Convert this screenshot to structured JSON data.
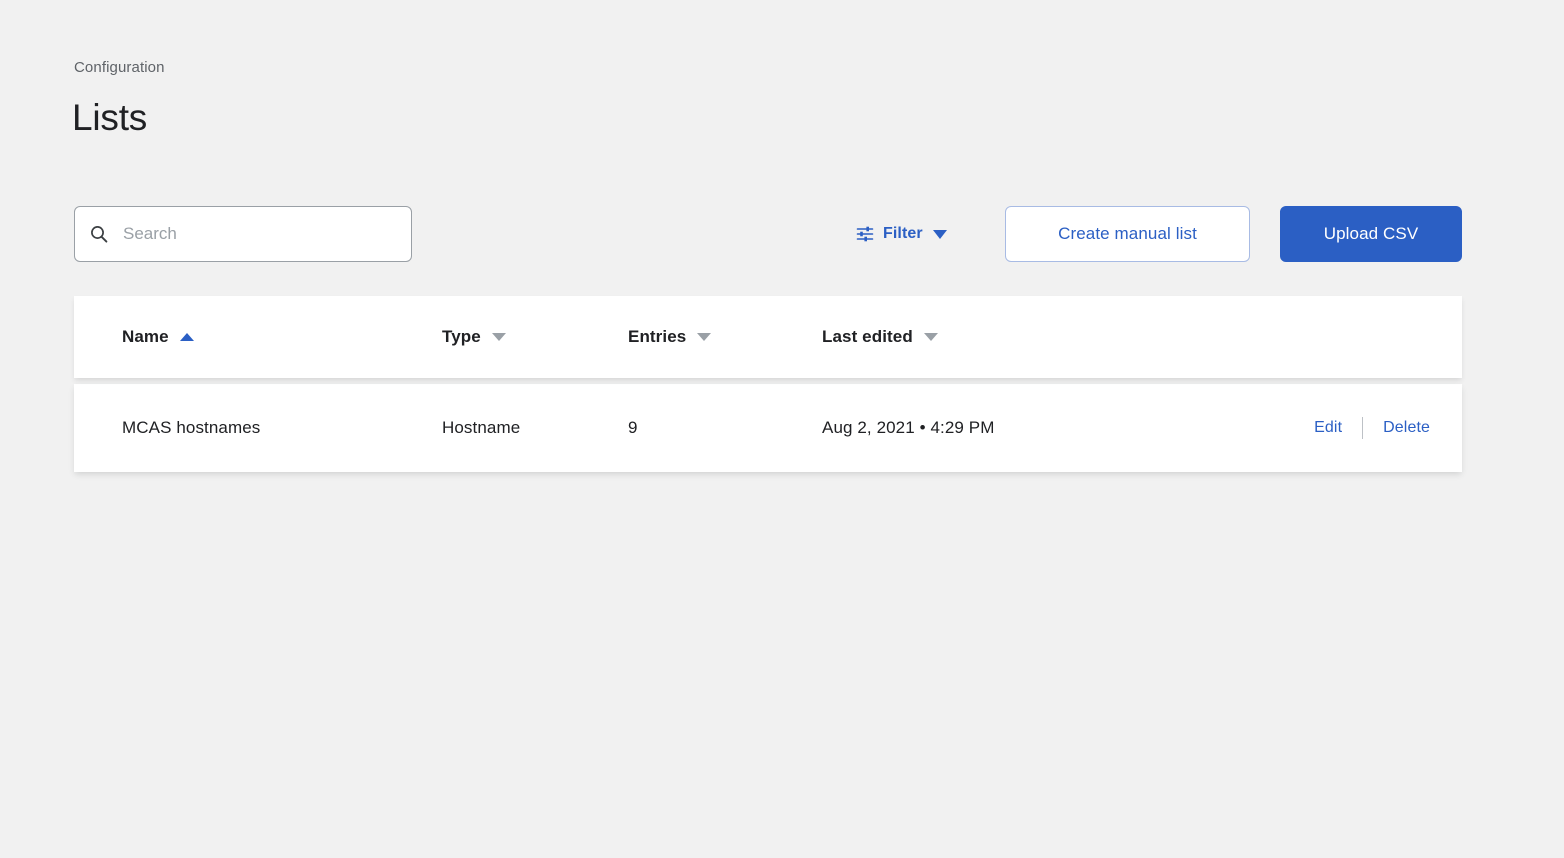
{
  "header": {
    "breadcrumb": "Configuration",
    "title": "Lists"
  },
  "toolbar": {
    "search": {
      "icon": "search-icon",
      "value": "",
      "placeholder": "Search"
    },
    "filter": {
      "icon": "tune-icon",
      "label": "Filter",
      "caret": "chevron-down-icon"
    },
    "create_manual_list_label": "Create manual list",
    "upload_csv_label": "Upload CSV"
  },
  "table": {
    "columns": [
      {
        "label": "Name",
        "sort": "asc"
      },
      {
        "label": "Type",
        "sort": "desc"
      },
      {
        "label": "Entries",
        "sort": "desc"
      },
      {
        "label": "Last edited",
        "sort": "desc"
      }
    ],
    "rows": [
      {
        "name": "MCAS hostnames",
        "type": "Hostname",
        "entries": "9",
        "last_edited": "Aug 2, 2021 • 4:29 PM",
        "edit_label": "Edit",
        "delete_label": "Delete"
      }
    ]
  },
  "colors": {
    "accent": "#2b5fc4",
    "page_background": "#f1f1f1",
    "card": "#ffffff",
    "text": "#202124",
    "muted": "#5f6368"
  }
}
